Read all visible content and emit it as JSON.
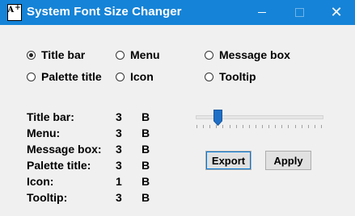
{
  "window": {
    "title": "System Font Size Changer",
    "icon_glyph": "A",
    "icon_plus": "+",
    "close_glyph": "✕",
    "accent_color": "#1583d7"
  },
  "options": [
    {
      "label": "Title bar",
      "checked": true
    },
    {
      "label": "Menu",
      "checked": false
    },
    {
      "label": "Message box",
      "checked": false
    },
    {
      "label": "Palette title",
      "checked": false
    },
    {
      "label": "Icon",
      "checked": false
    },
    {
      "label": "Tooltip",
      "checked": false
    }
  ],
  "sizes": [
    {
      "label": "Title bar:",
      "value": "3",
      "unit": "B"
    },
    {
      "label": "Menu:",
      "value": "3",
      "unit": "B"
    },
    {
      "label": "Message box:",
      "value": "3",
      "unit": "B"
    },
    {
      "label": "Palette title:",
      "value": "3",
      "unit": "B"
    },
    {
      "label": "Icon:",
      "value": "1",
      "unit": "B"
    },
    {
      "label": "Tooltip:",
      "value": "3",
      "unit": "B"
    }
  ],
  "slider": {
    "position_fraction": 0.17,
    "tick_count": 20,
    "thumb_color": "#1f6fc6"
  },
  "buttons": {
    "export_label": "Export",
    "apply_label": "Apply"
  }
}
